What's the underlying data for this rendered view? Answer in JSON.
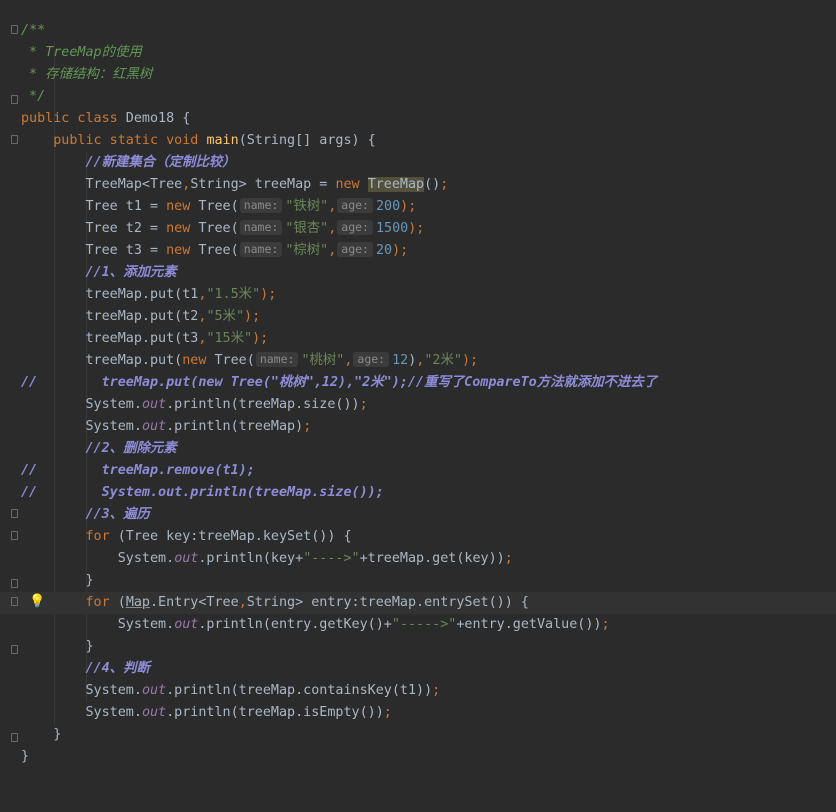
{
  "hints": {
    "name": "name:",
    "age": "age:"
  },
  "code": {
    "l1": "/**",
    "l2": " * TreeMap的使用",
    "l3": " * 存储结构：红黑树",
    "l4": " */",
    "l5": {
      "kw": "public class",
      "rest": " Demo18 {"
    },
    "l6": {
      "kw": "public static void",
      "fn": "main",
      "rest": "(String[] args) {"
    },
    "l7": "//新建集合（定制比较）",
    "l8": {
      "a": "TreeMap<Tree",
      "b": ",",
      "c": "String> treeMap = ",
      "kw": "new",
      "d": " ",
      "e": "TreeMap",
      "f": "()",
      "g": ";"
    },
    "l9": {
      "a": "Tree t1 = ",
      "kw": "new",
      "b": " Tree(",
      "s1": "\"铁树\"",
      "comma": ",",
      "n": "200",
      "end": ");"
    },
    "l10": {
      "a": "Tree t2 = ",
      "kw": "new",
      "b": " Tree(",
      "s1": "\"银杏\"",
      "comma": ",",
      "n": "1500",
      "end": ");"
    },
    "l11": {
      "a": "Tree t3 = ",
      "kw": "new",
      "b": " Tree(",
      "s1": "\"棕树\"",
      "comma": ",",
      "n": "20",
      "end": ");"
    },
    "l12": "//1、添加元素",
    "l13": {
      "a": "treeMap.put(t1",
      "comma": ",",
      "s": "\"1.5米\"",
      "end": ");"
    },
    "l14": {
      "a": "treeMap.put(t2",
      "comma": ",",
      "s": "\"5米\"",
      "end": ");"
    },
    "l15": {
      "a": "treeMap.put(t3",
      "comma": ",",
      "s": "\"15米\"",
      "end": ");"
    },
    "l16": {
      "a": "treeMap.put(",
      "kw": "new",
      "b": " Tree(",
      "s1": "\"桃树\"",
      "comma": ",",
      "n": "12",
      "c": ")",
      "comma2": ",",
      "s2": "\"2米\"",
      "end": ");"
    },
    "l17": {
      "slash": "//",
      "rest": "treeMap.put(new Tree(\"桃树\",12),\"2米\");//重写了CompareTo方法就添加不进去了"
    },
    "l18": {
      "a": "System.",
      "f": "out",
      "b": ".println(treeMap.size())",
      "end": ";"
    },
    "l19": {
      "a": "System.",
      "f": "out",
      "b": ".println(treeMap)",
      "end": ";"
    },
    "l20": "//2、删除元素",
    "l21": {
      "slash": "//",
      "rest": "treeMap.remove(t1);"
    },
    "l22": {
      "slash": "//",
      "rest": "System.out.println(treeMap.size());"
    },
    "l23": "//3、遍历",
    "l24": {
      "kw": "for",
      "rest": " (Tree key:treeMap.keySet()) {"
    },
    "l25": {
      "a": "System.",
      "f": "out",
      "b": ".println(key+",
      "s": "\"---->\"",
      "c": "+treeMap.get(key))",
      "end": ";"
    },
    "l26": "}",
    "l27": {
      "kw": "for",
      "a": " (",
      "u": "Map",
      "b": ".Entry<Tree",
      "comma": ",",
      "c": "String> entry:treeMap.entrySet()) {"
    },
    "l28": {
      "a": "System.",
      "f": "out",
      "b": ".println(entry.getKey()+",
      "s": "\"----->\"",
      "c": "+entry.getValue())",
      "end": ";"
    },
    "l29": "}",
    "l30": "//4、判断",
    "l31": {
      "a": "System.",
      "f": "out",
      "b": ".println(treeMap.containsKey(t1))",
      "end": ";"
    },
    "l32": {
      "a": "System.",
      "f": "out",
      "b": ".println(treeMap.isEmpty())",
      "end": ";"
    },
    "l33": "}",
    "l34": "}"
  }
}
